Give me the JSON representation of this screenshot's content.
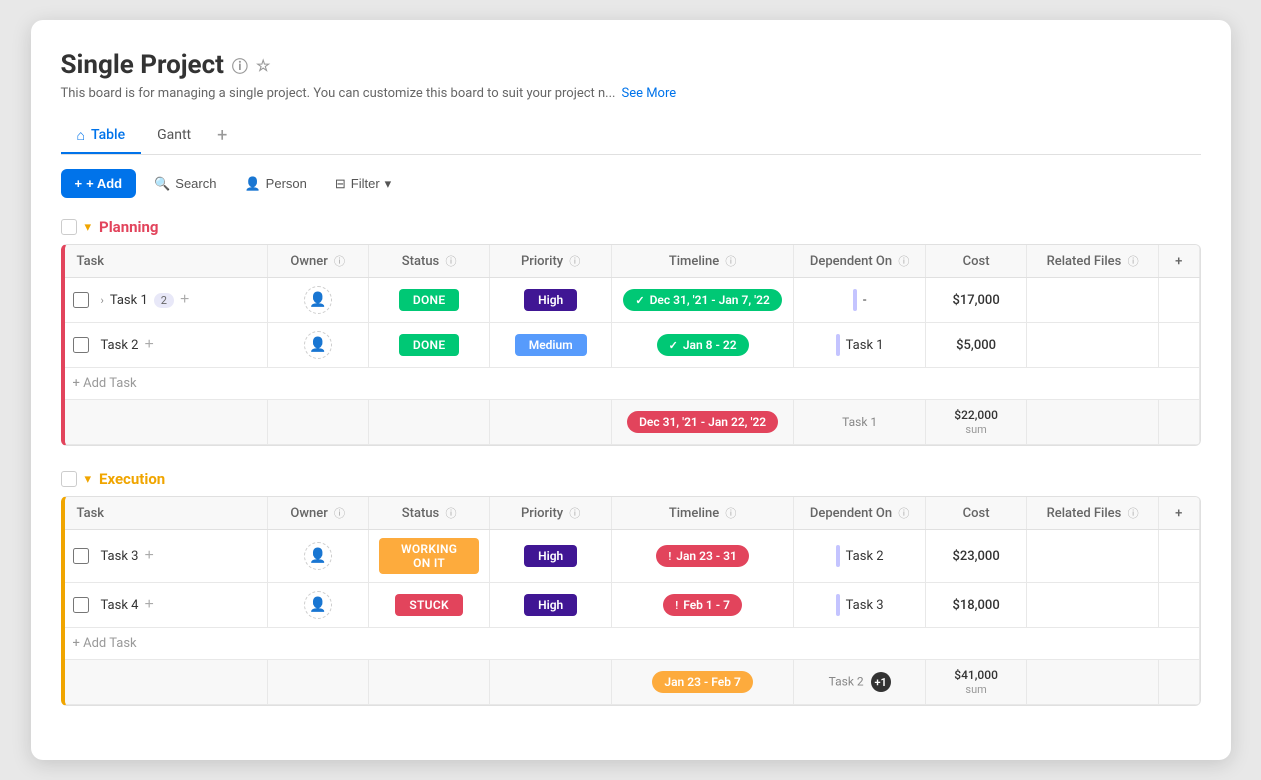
{
  "page": {
    "title": "Single Project",
    "description": "This board is for managing a single project. You can customize this board to suit your project n...",
    "see_more": "See More"
  },
  "tabs": [
    {
      "label": "Table",
      "icon": "🏠",
      "active": true
    },
    {
      "label": "Gantt",
      "active": false
    }
  ],
  "toolbar": {
    "add_label": "+ Add",
    "search_label": "Search",
    "person_label": "Person",
    "filter_label": "Filter"
  },
  "sections": [
    {
      "id": "planning",
      "name": "Planning",
      "color": "planning",
      "columns": [
        "Task",
        "Owner",
        "Status",
        "Priority",
        "Timeline",
        "Dependent On",
        "Cost",
        "Related Files"
      ],
      "rows": [
        {
          "task": "Task 1",
          "subtasks": "2",
          "has_chevron": true,
          "owner": "",
          "status": "Done",
          "status_class": "status-done",
          "priority": "High",
          "priority_class": "priority-high",
          "timeline": "Dec 31, '21 - Jan 7, '22",
          "timeline_class": "timeline-green",
          "timeline_icon": "✓",
          "dependent_on": "-",
          "cost": "$17,000",
          "related_files": ""
        },
        {
          "task": "Task 2",
          "subtasks": "",
          "has_chevron": false,
          "owner": "",
          "status": "Done",
          "status_class": "status-done",
          "priority": "Medium",
          "priority_class": "priority-medium",
          "timeline": "Jan 8 - 22",
          "timeline_class": "timeline-green",
          "timeline_icon": "✓",
          "dependent_on": "Task 1",
          "cost": "$5,000",
          "related_files": ""
        }
      ],
      "sum_timeline": "Dec 31, '21 - Jan 22, '22",
      "sum_timeline_class": "timeline-pink",
      "sum_dependent": "Task 1",
      "sum_cost": "$22,000",
      "sum_label": "sum"
    },
    {
      "id": "execution",
      "name": "Execution",
      "color": "execution",
      "columns": [
        "Task",
        "Owner",
        "Status",
        "Priority",
        "Timeline",
        "Dependent On",
        "Cost",
        "Related Files"
      ],
      "rows": [
        {
          "task": "Task 3",
          "subtasks": "",
          "has_chevron": false,
          "owner": "",
          "status": "Working on it",
          "status_class": "status-working",
          "priority": "High",
          "priority_class": "priority-high",
          "timeline": "Jan 23 - 31",
          "timeline_class": "timeline-pink",
          "timeline_icon": "!",
          "dependent_on": "Task 2",
          "cost": "$23,000",
          "related_files": ""
        },
        {
          "task": "Task 4",
          "subtasks": "",
          "has_chevron": false,
          "owner": "",
          "status": "Stuck",
          "status_class": "status-stuck",
          "priority": "High",
          "priority_class": "priority-high",
          "timeline": "Feb 1 - 7",
          "timeline_class": "timeline-pink",
          "timeline_icon": "!",
          "dependent_on": "Task 3",
          "cost": "$18,000",
          "related_files": ""
        }
      ],
      "sum_timeline": "Jan 23 - Feb 7",
      "sum_timeline_class": "timeline-orange",
      "sum_dependent": "Task 2",
      "sum_dependent_badge": "+1",
      "sum_cost": "$41,000",
      "sum_label": "sum"
    }
  ],
  "icons": {
    "info": "ⓘ",
    "star": "☆",
    "home": "⌂",
    "search": "🔍",
    "person": "👤",
    "filter": "⊟",
    "chevron_down": "▾",
    "chevron_right": "›",
    "plus": "+",
    "add_row": "+ Add Task"
  }
}
